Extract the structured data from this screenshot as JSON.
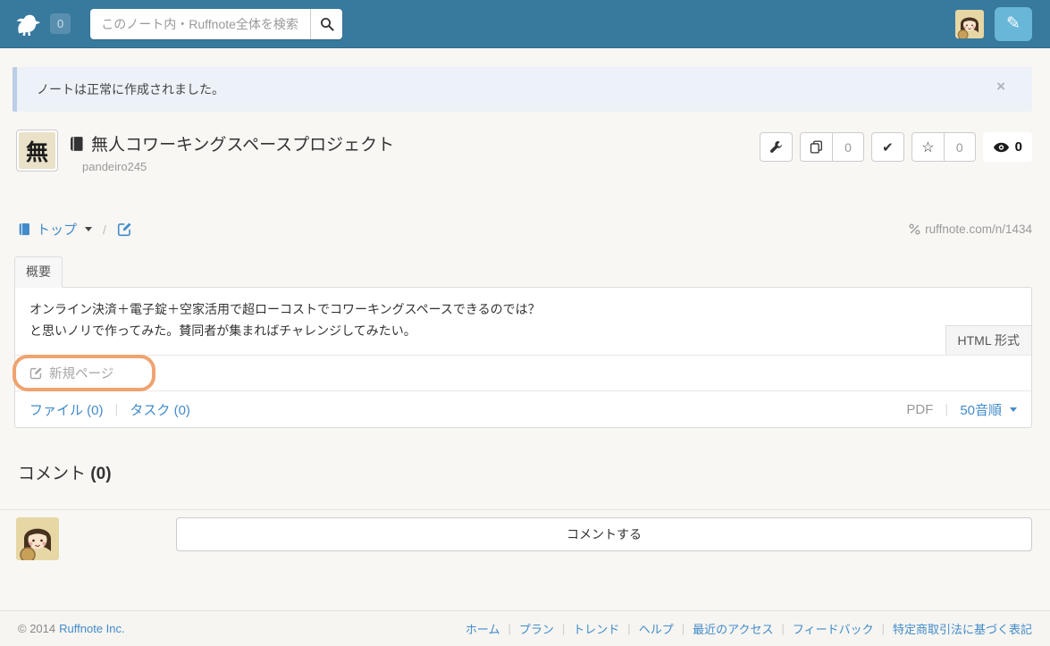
{
  "header": {
    "logo_badge": "0",
    "search_placeholder": "このノート内・Ruffnote全体を検索"
  },
  "notification": {
    "message": "ノートは正常に作成されました。",
    "close": "×"
  },
  "note": {
    "thumbnail_char": "無",
    "title": "無人コワーキングスペースプロジェクト",
    "owner": "pandeiro245",
    "fork_count": "0",
    "star_count": "0",
    "watch_count": "0"
  },
  "breadcrumb": {
    "top_label": "トップ",
    "separator": "/",
    "url": "ruffnote.com/n/1434"
  },
  "panel": {
    "tab_label": "概要",
    "body_line1": "オンライン決済＋電子錠＋空家活用で超ローコストでコワーキングスペースできるのでは？",
    "body_line2": "と思いノリで作ってみた。賛同者が集まればチャレンジしてみたい。",
    "html_format_label": "HTML 形式",
    "new_page_label": "新規ページ",
    "files_label": "ファイル (0)",
    "tasks_label": "タスク (0)",
    "pdf_label": "PDF",
    "sort_label": "50音順"
  },
  "comments": {
    "heading": "コメント",
    "count": "(0)",
    "button_label": "コメントする"
  },
  "footer": {
    "copyright": "© 2014",
    "company": "Ruffnote Inc.",
    "links": [
      "ホーム",
      "プラン",
      "トレンド",
      "ヘルプ",
      "最近のアクセス",
      "フィードバック",
      "特定商取引法に基づく表記"
    ]
  },
  "colors": {
    "header_bg": "#38799e",
    "accent_blue": "#428bca",
    "compose_button_blue": "#68b6d8",
    "annotation_orange": "#efa36f",
    "alert_bg": "#edf2f9"
  }
}
